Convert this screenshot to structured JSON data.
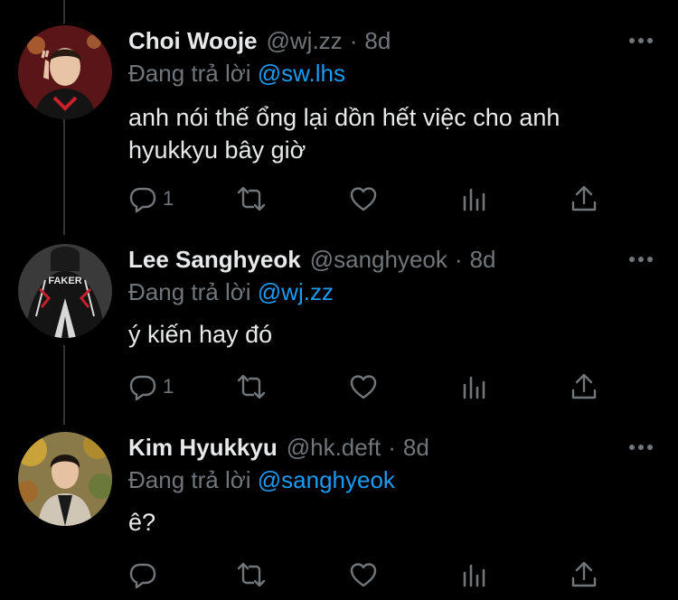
{
  "tweets": [
    {
      "name": "Choi Wooje",
      "handle": "@wj.zz",
      "dot": "·",
      "time": "8d",
      "reply_prefix": "Đang trả lời ",
      "reply_to": "@sw.lhs",
      "body": "anh nói thế ổng lại dồn hết việc cho anh hyukkyu bây giờ",
      "reply_count": "1"
    },
    {
      "name": "Lee Sanghyeok",
      "handle": "@sanghyeok",
      "dot": "·",
      "time": "8d",
      "reply_prefix": "Đang trả lời ",
      "reply_to": "@wj.zz",
      "body": "ý kiến hay đó",
      "reply_count": "1"
    },
    {
      "name": "Kim Hyukkyu",
      "handle": "@hk.deft",
      "dot": "·",
      "time": "8d",
      "reply_prefix": "Đang trả lời ",
      "reply_to": "@sanghyeok",
      "body": "ê?",
      "reply_count": ""
    }
  ],
  "icons": {
    "reply": "speech-bubble-icon",
    "retweet": "retweet-icon",
    "like": "heart-icon",
    "views": "bar-chart-icon",
    "share": "share-upload-icon",
    "more": "more-dots-icon"
  },
  "colors": {
    "background": "#000000",
    "text": "#e7e9ea",
    "muted": "#71767b",
    "mention": "#1d9bf0",
    "thread_line": "#333639"
  }
}
